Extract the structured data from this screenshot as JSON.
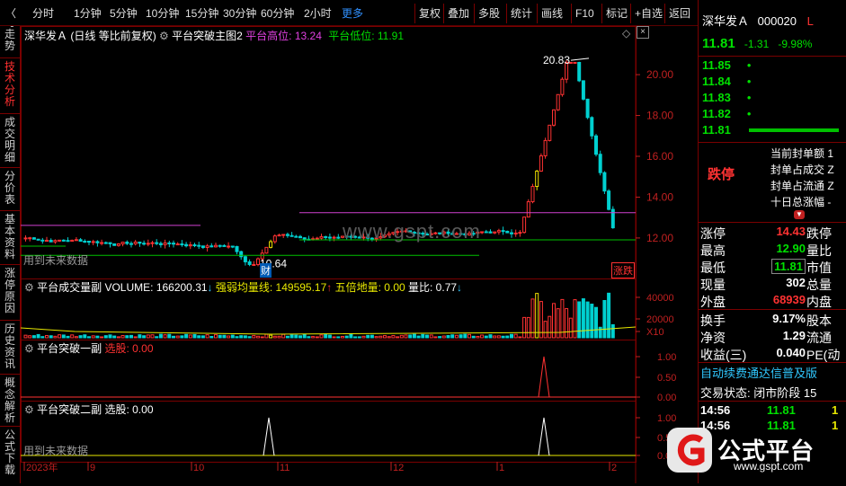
{
  "toolbar": {
    "back_arrow": "〈",
    "period_tabs": [
      "分时",
      "1分钟",
      "5分钟",
      "10分钟",
      "15分钟",
      "30分钟",
      "60分钟",
      "2小时",
      "更多"
    ],
    "function_tabs": [
      "复权",
      "叠加",
      "多股",
      "统计",
      "画线",
      "F10",
      "标记",
      "+自选",
      "返回"
    ]
  },
  "sidebar": {
    "items": [
      "分时走势",
      "技术分析",
      "成交明细",
      "分价表",
      "基本资料",
      "涨停原因",
      "历史资讯",
      "概念解析",
      "公式下载"
    ],
    "active_index": 1
  },
  "main_chart": {
    "stock_name": "深华发Ａ",
    "adjust": "(日线 等比前复权)",
    "indicator": "平台突破主图2",
    "high_label": "平台高位: 13.24",
    "low_label": "平台低位: 11.91",
    "price_ticks": [
      "20.00",
      "18.00",
      "16.00",
      "14.00",
      "12.00"
    ],
    "max_label": "20.83",
    "min_label": "10.64",
    "note_future": "用到未来数据",
    "flag_cai": "财",
    "flag_zhangdie": "涨跌",
    "watermark": "www.gspt.com"
  },
  "volume_panel": {
    "title": "平台成交量副",
    "volume_label": "VOLUME: 166200.31",
    "ma_label": "强弱均量线: 149595.17",
    "wudi_label": "五倍地量: 0.00",
    "ratio_label": "量比: 0.77",
    "ticks": [
      "40000",
      "20000",
      "X10"
    ]
  },
  "sub1": {
    "title": "平台突破一副",
    "select_label": "选股: 0.00",
    "ticks": [
      "1.00",
      "0.50",
      "0.00"
    ]
  },
  "sub2": {
    "title": "平台突破二副",
    "select_label": "选股: 0.00",
    "ticks": [
      "1.00",
      "0.50",
      "0.00"
    ],
    "note_future": "用到未来数据"
  },
  "x_axis": [
    "2023年",
    "9",
    "10",
    "11",
    "12",
    "1",
    "2"
  ],
  "quote": {
    "name": "深华发Ａ",
    "code": "000020",
    "price": "11.81",
    "change": "-1.31",
    "pct": "-9.98%",
    "book": [
      {
        "price": "11.85",
        "vol": "•"
      },
      {
        "price": "11.84",
        "vol": "•"
      },
      {
        "price": "11.83",
        "vol": "•"
      },
      {
        "price": "11.82",
        "vol": "•"
      },
      {
        "price": "11.81",
        "vol": ""
      }
    ],
    "limit_status": "跌停",
    "limit_info": [
      "当前封单额 1",
      "封单占成交 Z",
      "封单占流通 Z",
      "十日总涨幅 -"
    ],
    "stats": [
      {
        "k": "涨停",
        "v": "14.43",
        "k2": "跌停"
      },
      {
        "k": "最高",
        "v": "12.90",
        "k2": "量比"
      },
      {
        "k": "最低",
        "v": "11.81",
        "k2": "市值"
      },
      {
        "k": "现量",
        "v": "302",
        "k2": "总量"
      },
      {
        "k": "外盘",
        "v": "68939",
        "k2": "内盘"
      }
    ],
    "stats2": [
      {
        "k": "换手",
        "v": "9.17%",
        "k2": "股本"
      },
      {
        "k": "净资",
        "v": "1.29",
        "k2": "流通"
      },
      {
        "k": "收益(三)",
        "v": "0.040",
        "k2": "PE(动"
      }
    ],
    "marquee": "自动续费通达信普及版",
    "trade_status": "交易状态: 闭市阶段 15",
    "ticks": [
      {
        "time": "14:56",
        "price": "11.81",
        "vol": "1"
      },
      {
        "time": "14:56",
        "price": "11.81",
        "vol": "1"
      }
    ]
  },
  "brand": {
    "name": "公式平台",
    "url": "www.gspt.com"
  },
  "colors": {
    "up": "#ff3232",
    "down": "#00d0d0",
    "bg": "#000000",
    "grid": "#7a0000"
  }
}
